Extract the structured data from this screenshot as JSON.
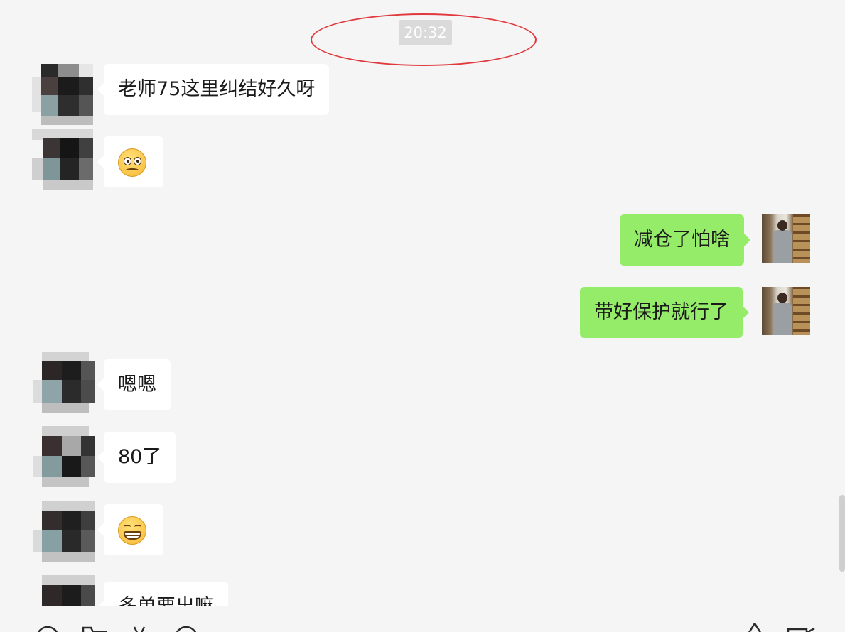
{
  "chat": {
    "timestamp": "20:32",
    "messages": [
      {
        "from": "contact",
        "text": "老师75这里纠结好久呀"
      },
      {
        "from": "contact",
        "emoji": "woozy-face-emoji"
      },
      {
        "from": "self",
        "text": "减仓了怕啥"
      },
      {
        "from": "self",
        "text": "带好保护就行了"
      },
      {
        "from": "contact",
        "text": "嗯嗯"
      },
      {
        "from": "contact",
        "text": "80了"
      },
      {
        "from": "contact",
        "emoji": "grinning-face-emoji"
      },
      {
        "from": "contact",
        "text": "多单要出嘛"
      }
    ]
  },
  "annotation": {
    "color": "#e0393e"
  },
  "colors": {
    "outgoing_bubble": "#95ec69",
    "incoming_bubble": "#ffffff",
    "background": "#f5f5f5"
  },
  "toolbar": {
    "icons": [
      "emoji-icon",
      "folder-icon",
      "scissors-icon",
      "chat-history-icon",
      "voice-call-icon",
      "video-call-icon"
    ]
  }
}
